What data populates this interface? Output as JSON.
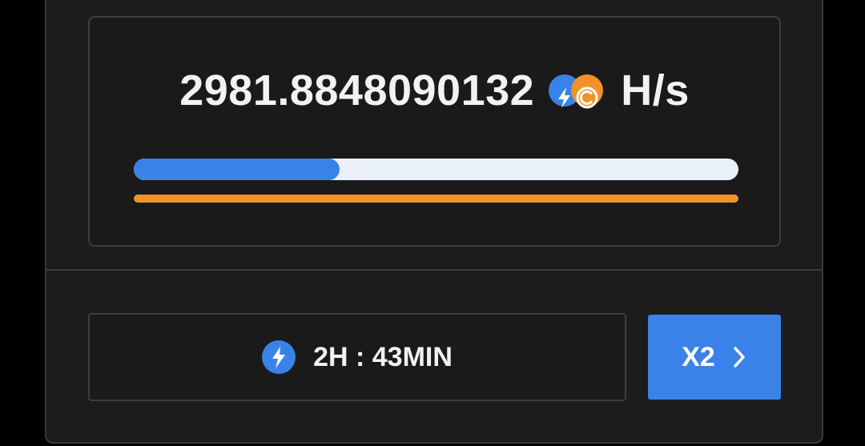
{
  "mining": {
    "hashrate_value": "2981.8848090132",
    "hashrate_unit": "H/s",
    "progress_fraction": 0.34
  },
  "icons": {
    "coin_pair": [
      "bolt-icon",
      "coin-icon"
    ],
    "timer": "bolt-icon",
    "boost_chevron": "chevron-right-icon"
  },
  "boost": {
    "time_remaining": "2H : 43MIN",
    "button_label": "X2"
  },
  "colors": {
    "accent_blue": "#3b82e8",
    "accent_orange": "#f0922a",
    "track_light": "#eaf1fb",
    "panel_bg": "#1c1c1c"
  }
}
